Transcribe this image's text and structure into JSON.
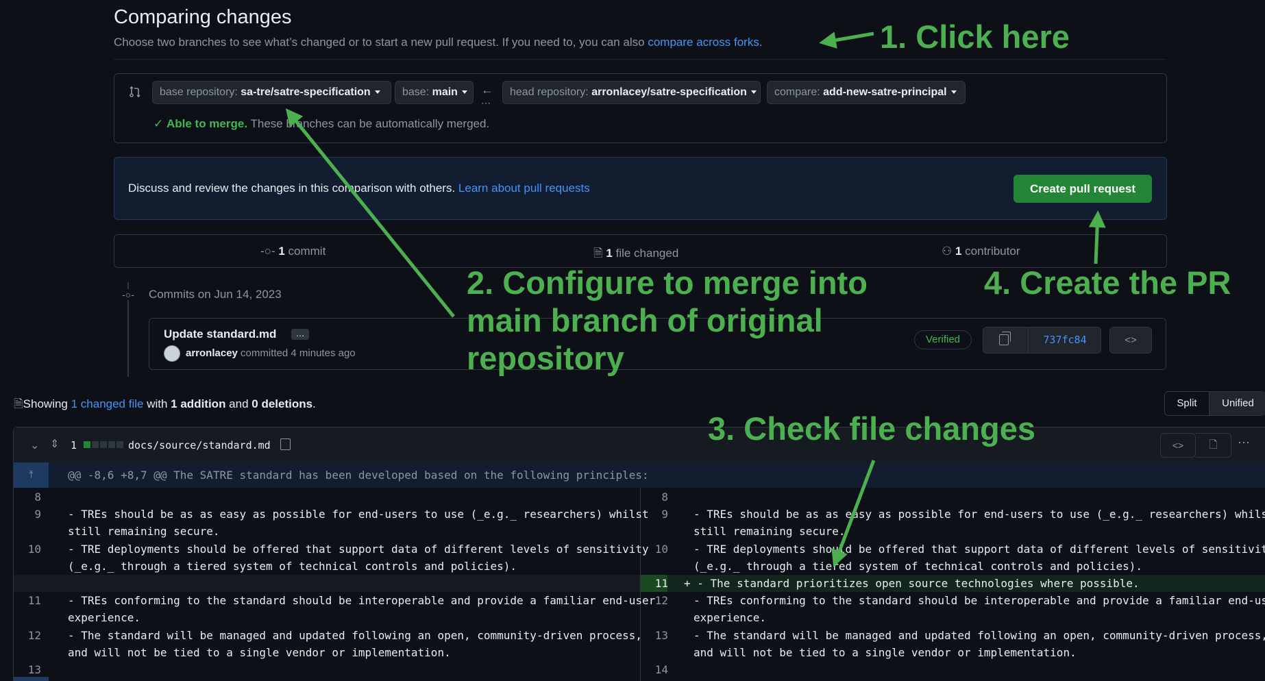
{
  "header": {
    "title": "Comparing changes",
    "subtitle": "Choose two branches to see what’s changed or to start a new pull request. If you need to, you can also ",
    "subtitle_link": "compare across forks",
    "subtitle_end": "."
  },
  "compare_bar": {
    "base_repo_label": "base repository: ",
    "base_repo_value": "sa-tre/satre-specification",
    "base_label": "base: ",
    "base_value": "main",
    "head_repo_label": "head repository: ",
    "head_repo_value": "arronlacey/satre-specification",
    "compare_label": "compare: ",
    "compare_value": "add-new-satre-principal",
    "merge_status": "Able to merge.",
    "merge_detail": " These branches can be automatically merged."
  },
  "discuss": {
    "text": "Discuss and review the changes in this comparison with others. ",
    "link": "Learn about pull requests",
    "create_button": "Create pull request"
  },
  "stats": {
    "commits_count": "1",
    "commits_label": " commit",
    "files_count": "1",
    "files_label": " file changed",
    "contributors_count": "1",
    "contributors_label": " contributor"
  },
  "commits": {
    "date_heading": "Commits on Jun 14, 2023",
    "message": "Update standard.md",
    "ellipsis": "…",
    "author": "arronlacey",
    "meta": " committed 4 minutes ago",
    "verified": "Verified",
    "sha": "737fc84"
  },
  "summary": {
    "showing": "Showing ",
    "changed_file": "1 changed file",
    "with": " with ",
    "additions": "1 addition",
    "and": " and ",
    "deletions": "0 deletions",
    "end": "."
  },
  "view_toggle": {
    "split": "Split",
    "unified": "Unified"
  },
  "file": {
    "change_count": "1",
    "path": "docs/source/standard.md",
    "hunk": "@@ -8,6 +8,7 @@ The SATRE standard has been developed based on the following principles:"
  },
  "diff_left": [
    {
      "num": "8",
      "lines": [
        ""
      ]
    },
    {
      "num": "9",
      "lines": [
        "- TREs should be as as easy as possible for end-users to use (_e.g._ researchers) whilst",
        "still remaining secure."
      ]
    },
    {
      "num": "10",
      "lines": [
        "- TRE deployments should be offered that support data of different levels of sensitivity",
        "(_e.g._ through a tiered system of technical controls and policies)."
      ]
    },
    {
      "num": "11",
      "lines": [
        "- TREs conforming to the standard should be interoperable and provide a familiar end-user",
        "experience."
      ]
    },
    {
      "num": "12",
      "lines": [
        "- The standard will be managed and updated following an open, community-driven process,",
        "and will not be tied to a single vendor or implementation."
      ]
    },
    {
      "num": "13",
      "lines": [
        ""
      ]
    }
  ],
  "diff_right": [
    {
      "num": "8",
      "lines": [
        ""
      ]
    },
    {
      "num": "9",
      "lines": [
        "- TREs should be as as easy as possible for end-users to use (_e.g._ researchers) whilst",
        "still remaining secure."
      ]
    },
    {
      "num": "10",
      "lines": [
        "- TRE deployments should be offered that support data of different levels of sensitivity",
        "(_e.g._ through a tiered system of technical controls and policies)."
      ]
    },
    {
      "num": "11",
      "added": "+ - The standard prioritizes open source technologies where possible."
    },
    {
      "num": "12",
      "lines": [
        "- TREs conforming to the standard should be interoperable and provide a familiar end-user",
        "experience."
      ]
    },
    {
      "num": "13",
      "lines": [
        "- The standard will be managed and updated following an open, community-driven process,",
        "and will not be tied to a single vendor or implementation."
      ]
    },
    {
      "num": "14",
      "lines": [
        ""
      ]
    }
  ],
  "annotations": {
    "step1": "1. Click here",
    "step2_line1": "2. Configure to merge into",
    "step2_line2": "main branch of original",
    "step2_line3": "repository",
    "step3": "3. Check file changes",
    "step4": "4. Create the PR",
    "color": "#4caf50"
  },
  "colors": {
    "background": "#0d1117",
    "border": "#30363d",
    "link": "#4493f8",
    "primary_button": "#238636",
    "added_bg": "#12261e",
    "hunk_bg": "#121d2f"
  }
}
